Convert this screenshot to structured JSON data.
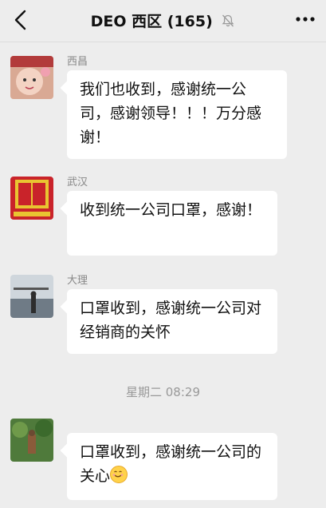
{
  "header": {
    "title": "DEO 西区 (165)",
    "back_icon": "chevron-left-icon",
    "mute_icon": "bell-muted-icon",
    "more_icon": "more-dots-icon"
  },
  "messages": [
    {
      "sender": "西昌",
      "text": "  我们也收到，感谢统一公司，感谢领导！！！万分感谢！"
    },
    {
      "sender": "武汉",
      "text": "收到统一公司口罩，感谢！"
    },
    {
      "sender": "大理",
      "text": "口罩收到，感谢统一公司对经销商的关怀"
    },
    {
      "sender": "",
      "text": "口罩收到，感谢统一公司的关心"
    }
  ],
  "timestamp": "星期二 08:29",
  "colors": {
    "background": "#ededed",
    "bubble": "#ffffff",
    "meta_text": "#888888"
  }
}
